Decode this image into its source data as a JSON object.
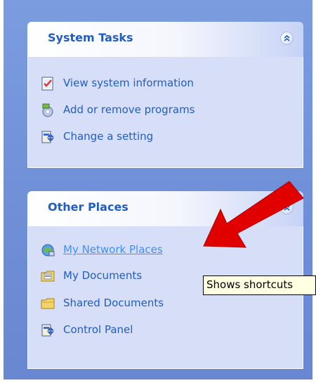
{
  "system_tasks": {
    "title": "System Tasks",
    "collapse_icon": "chevron-double-up-icon",
    "items": [
      {
        "label": "View system information",
        "icon": "system-information-icon"
      },
      {
        "label": "Add or remove programs",
        "icon": "add-remove-programs-icon"
      },
      {
        "label": "Change a setting",
        "icon": "control-panel-icon"
      }
    ]
  },
  "other_places": {
    "title": "Other Places",
    "collapse_icon": "chevron-double-up-icon",
    "items": [
      {
        "label": "My Network Places",
        "icon": "network-places-icon",
        "hovered": true
      },
      {
        "label": "My Documents",
        "icon": "my-documents-icon"
      },
      {
        "label": "Shared Documents",
        "icon": "folder-icon"
      },
      {
        "label": "Control Panel",
        "icon": "control-panel-icon"
      }
    ]
  },
  "tooltip": {
    "text": "Shows shortcuts"
  },
  "colors": {
    "pane_background": "#7b9ddf",
    "panel_body": "#d6dff7",
    "link_text": "#215dc6",
    "hover_link": "#428eff",
    "tooltip_bg": "#ffffe1",
    "annotation_arrow": "#e00000"
  }
}
